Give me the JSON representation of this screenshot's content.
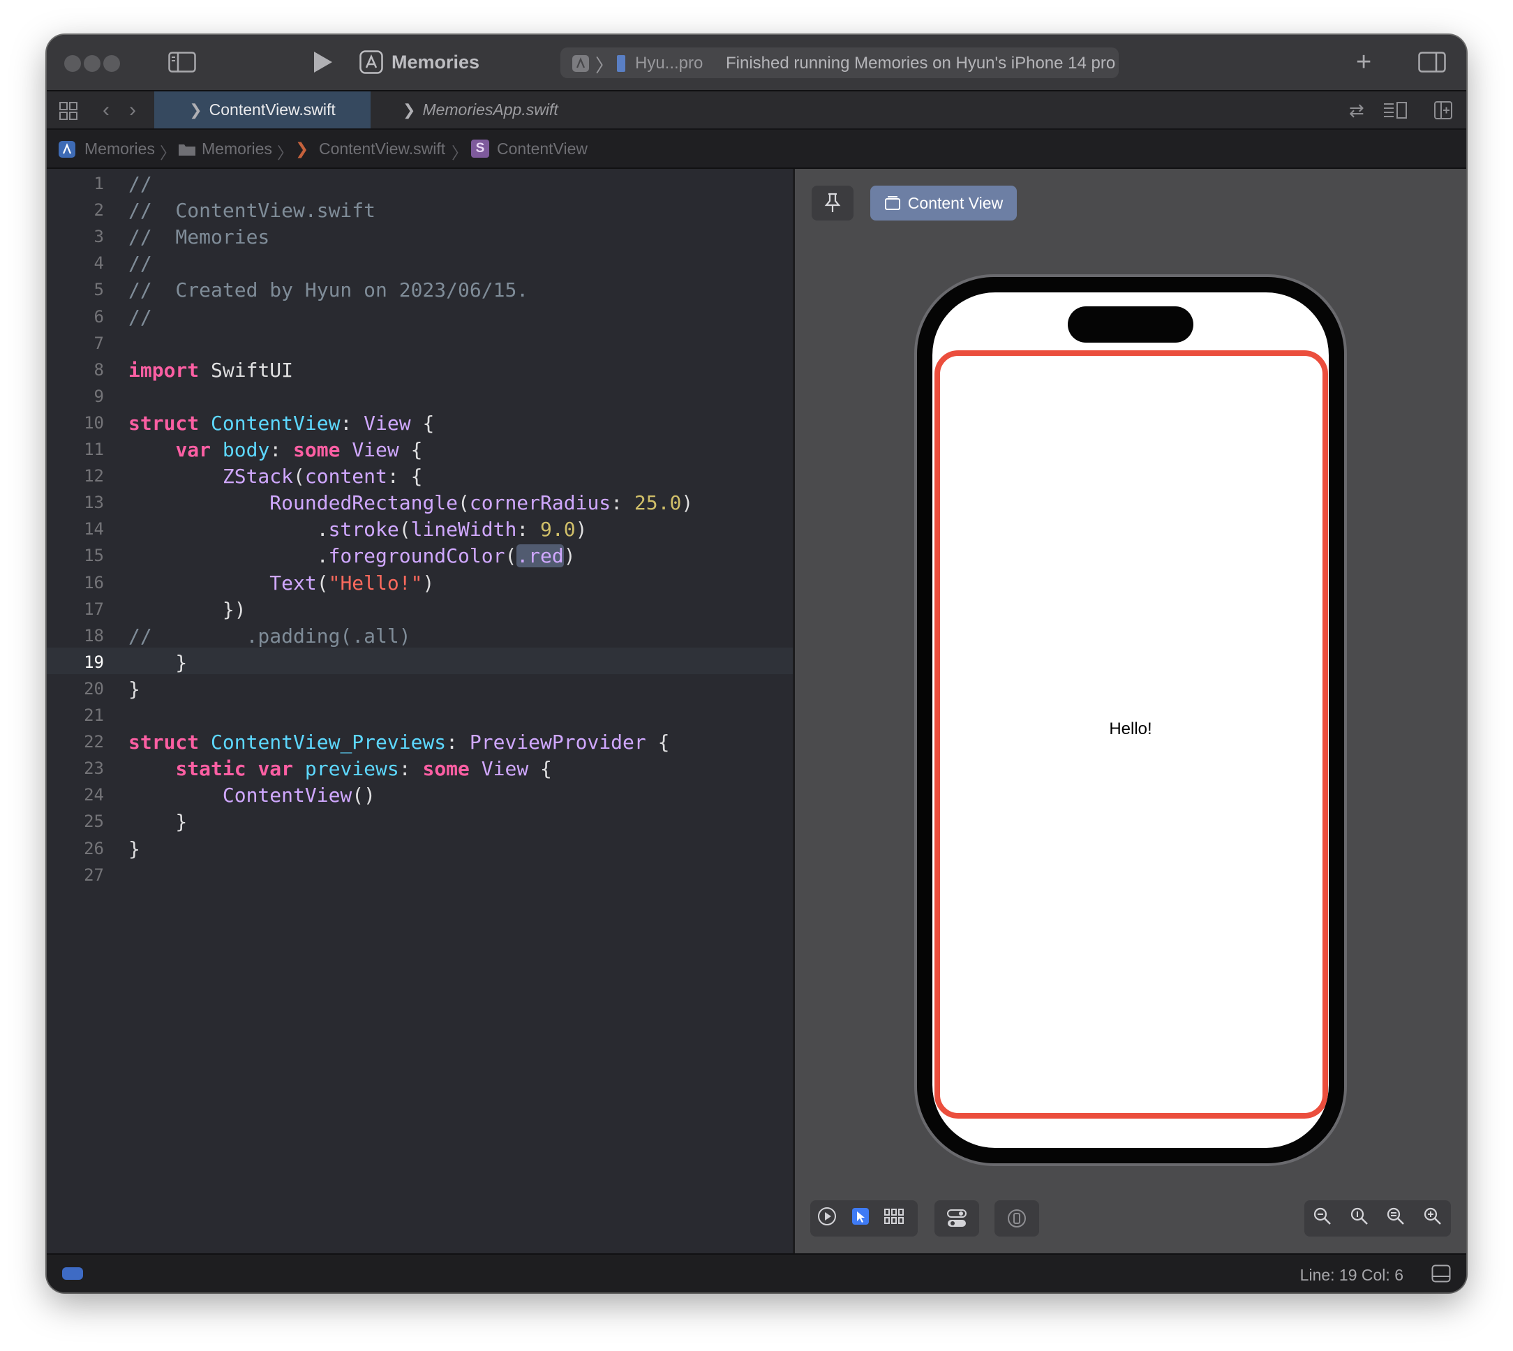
{
  "toolbar": {
    "scheme": "Memories",
    "destination": "Hyu...pro",
    "status": "Finished running Memories on Hyun's iPhone 14 pro"
  },
  "tabs": [
    {
      "label": "ContentView.swift",
      "active": true
    },
    {
      "label": "MemoriesApp.swift",
      "active": false
    }
  ],
  "breadcrumb": [
    {
      "icon": "app-icon",
      "label": "Memories"
    },
    {
      "icon": "folder-icon",
      "label": "Memories"
    },
    {
      "icon": "swift-file-icon",
      "label": "ContentView.swift"
    },
    {
      "icon": "struct-icon",
      "label": "ContentView",
      "badge": "S"
    }
  ],
  "editor": {
    "current_line": 19,
    "lines": [
      {
        "n": "1",
        "code": [
          {
            "t": "//",
            "c": "com"
          }
        ]
      },
      {
        "n": "2",
        "code": [
          {
            "t": "//  ContentView.swift",
            "c": "com"
          }
        ]
      },
      {
        "n": "3",
        "code": [
          {
            "t": "//  Memories",
            "c": "com"
          }
        ]
      },
      {
        "n": "4",
        "code": [
          {
            "t": "//",
            "c": "com"
          }
        ]
      },
      {
        "n": "5",
        "code": [
          {
            "t": "//  Created by Hyun on 2023/06/15.",
            "c": "com"
          }
        ]
      },
      {
        "n": "6",
        "code": [
          {
            "t": "//",
            "c": "com"
          }
        ]
      },
      {
        "n": "7",
        "code": []
      },
      {
        "n": "8",
        "code": [
          {
            "t": "import",
            "c": "kw"
          },
          {
            "t": " SwiftUI",
            "c": "plain"
          }
        ]
      },
      {
        "n": "9",
        "code": []
      },
      {
        "n": "10",
        "code": [
          {
            "t": "struct",
            "c": "kw"
          },
          {
            "t": " ",
            "c": "plain"
          },
          {
            "t": "ContentView",
            "c": "type"
          },
          {
            "t": ": ",
            "c": "plain"
          },
          {
            "t": "View",
            "c": "sys"
          },
          {
            "t": " {",
            "c": "plain"
          }
        ]
      },
      {
        "n": "11",
        "code": [
          {
            "t": "    ",
            "c": "plain"
          },
          {
            "t": "var",
            "c": "kw"
          },
          {
            "t": " ",
            "c": "plain"
          },
          {
            "t": "body",
            "c": "type"
          },
          {
            "t": ": ",
            "c": "plain"
          },
          {
            "t": "some",
            "c": "kw"
          },
          {
            "t": " ",
            "c": "plain"
          },
          {
            "t": "View",
            "c": "sys"
          },
          {
            "t": " {",
            "c": "plain"
          }
        ]
      },
      {
        "n": "12",
        "code": [
          {
            "t": "        ",
            "c": "plain"
          },
          {
            "t": "ZStack",
            "c": "sys"
          },
          {
            "t": "(",
            "c": "plain"
          },
          {
            "t": "content",
            "c": "sys"
          },
          {
            "t": ": {",
            "c": "plain"
          }
        ]
      },
      {
        "n": "13",
        "code": [
          {
            "t": "            ",
            "c": "plain"
          },
          {
            "t": "RoundedRectangle",
            "c": "sys"
          },
          {
            "t": "(",
            "c": "plain"
          },
          {
            "t": "cornerRadius",
            "c": "sys"
          },
          {
            "t": ": ",
            "c": "plain"
          },
          {
            "t": "25.0",
            "c": "num"
          },
          {
            "t": ")",
            "c": "plain"
          }
        ]
      },
      {
        "n": "14",
        "code": [
          {
            "t": "                .",
            "c": "plain"
          },
          {
            "t": "stroke",
            "c": "sys"
          },
          {
            "t": "(",
            "c": "plain"
          },
          {
            "t": "lineWidth",
            "c": "sys"
          },
          {
            "t": ": ",
            "c": "plain"
          },
          {
            "t": "9.0",
            "c": "num"
          },
          {
            "t": ")",
            "c": "plain"
          }
        ]
      },
      {
        "n": "15",
        "code": [
          {
            "t": "                .",
            "c": "plain"
          },
          {
            "t": "foregroundColor",
            "c": "sys"
          },
          {
            "t": "(",
            "c": "plain"
          },
          {
            "t": ".red",
            "c": "sel"
          },
          {
            "t": ")",
            "c": "plain"
          }
        ]
      },
      {
        "n": "16",
        "code": [
          {
            "t": "            ",
            "c": "plain"
          },
          {
            "t": "Text",
            "c": "sys"
          },
          {
            "t": "(",
            "c": "plain"
          },
          {
            "t": "\"Hello!\"",
            "c": "str"
          },
          {
            "t": ")",
            "c": "plain"
          }
        ]
      },
      {
        "n": "17",
        "code": [
          {
            "t": "        })",
            "c": "plain"
          }
        ]
      },
      {
        "n": "18",
        "code": [
          {
            "t": "//        .padding(.all)",
            "c": "com"
          }
        ]
      },
      {
        "n": "19",
        "code": [
          {
            "t": "    }",
            "c": "plain"
          }
        ]
      },
      {
        "n": "20",
        "code": [
          {
            "t": "}",
            "c": "plain"
          }
        ]
      },
      {
        "n": "21",
        "code": []
      },
      {
        "n": "22",
        "code": [
          {
            "t": "struct",
            "c": "kw"
          },
          {
            "t": " ",
            "c": "plain"
          },
          {
            "t": "ContentView_Previews",
            "c": "type"
          },
          {
            "t": ": ",
            "c": "plain"
          },
          {
            "t": "PreviewProvider",
            "c": "sys"
          },
          {
            "t": " {",
            "c": "plain"
          }
        ]
      },
      {
        "n": "23",
        "code": [
          {
            "t": "    ",
            "c": "plain"
          },
          {
            "t": "static",
            "c": "kw"
          },
          {
            "t": " ",
            "c": "plain"
          },
          {
            "t": "var",
            "c": "kw"
          },
          {
            "t": " ",
            "c": "plain"
          },
          {
            "t": "previews",
            "c": "type"
          },
          {
            "t": ": ",
            "c": "plain"
          },
          {
            "t": "some",
            "c": "kw"
          },
          {
            "t": " ",
            "c": "plain"
          },
          {
            "t": "View",
            "c": "sys"
          },
          {
            "t": " {",
            "c": "plain"
          }
        ]
      },
      {
        "n": "24",
        "code": [
          {
            "t": "        ",
            "c": "plain"
          },
          {
            "t": "ContentView",
            "c": "sys"
          },
          {
            "t": "()",
            "c": "plain"
          }
        ]
      },
      {
        "n": "25",
        "code": [
          {
            "t": "    }",
            "c": "plain"
          }
        ]
      },
      {
        "n": "26",
        "code": [
          {
            "t": "}",
            "c": "plain"
          }
        ]
      },
      {
        "n": "27",
        "code": []
      }
    ]
  },
  "canvas": {
    "preview_label": "Content View",
    "preview_text": "Hello!",
    "stroke_color": "#eb4e3d"
  },
  "statusbar": {
    "position": "Line: 19  Col: 6"
  }
}
